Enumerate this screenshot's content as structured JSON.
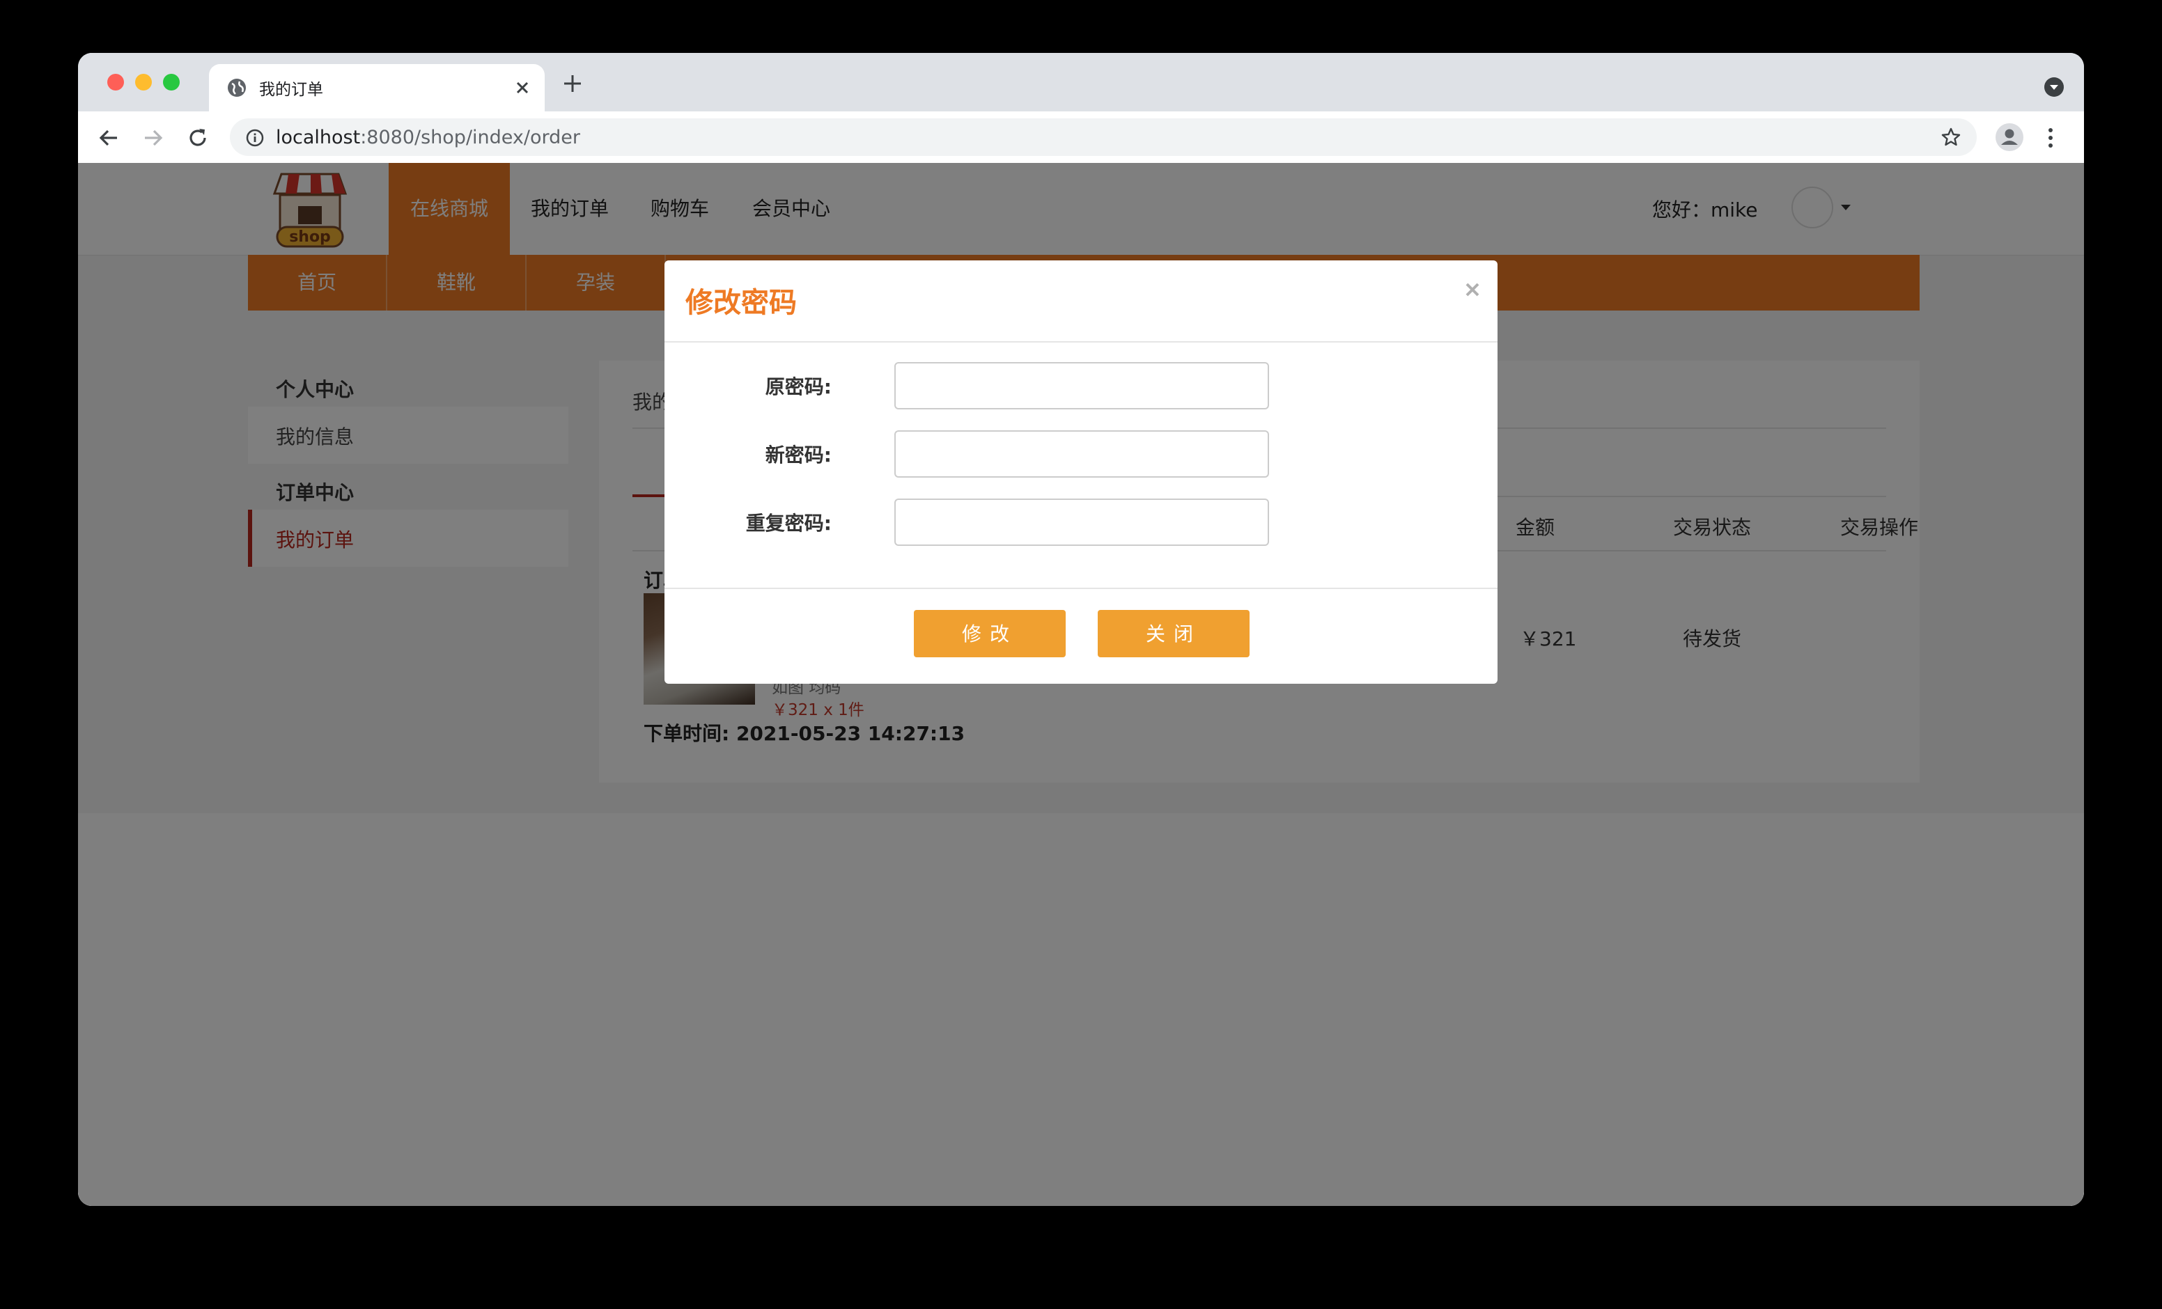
{
  "browser": {
    "tab_title": "我的订单",
    "url_host": "localhost",
    "url_rest": ":8080/shop/index/order"
  },
  "header": {
    "logo_text": "shop",
    "nav": [
      "在线商城",
      "我的订单",
      "购物车",
      "会员中心"
    ],
    "greeting": "您好：mike"
  },
  "categories": [
    "首页",
    "鞋靴",
    "孕装"
  ],
  "sidebar": {
    "group1": "个人中心",
    "item1": "我的信息",
    "group2": "订单中心",
    "item2": "我的订单"
  },
  "content": {
    "title": "我的订单",
    "columns": [
      "金额",
      "交易状态",
      "交易操作"
    ],
    "order": {
      "no_label": "订单号",
      "spec": "如图 均码",
      "price_qty": "￥321 x 1件",
      "amount": "￥321",
      "status": "待发货",
      "time": "下单时间: 2021-05-23 14:27:13"
    }
  },
  "modal": {
    "title": "修改密码",
    "fields": [
      {
        "label": "原密码:",
        "value": ""
      },
      {
        "label": "新密码:",
        "value": ""
      },
      {
        "label": "重复密码:",
        "value": ""
      }
    ],
    "submit_label": "修改",
    "close_label": "关闭"
  }
}
